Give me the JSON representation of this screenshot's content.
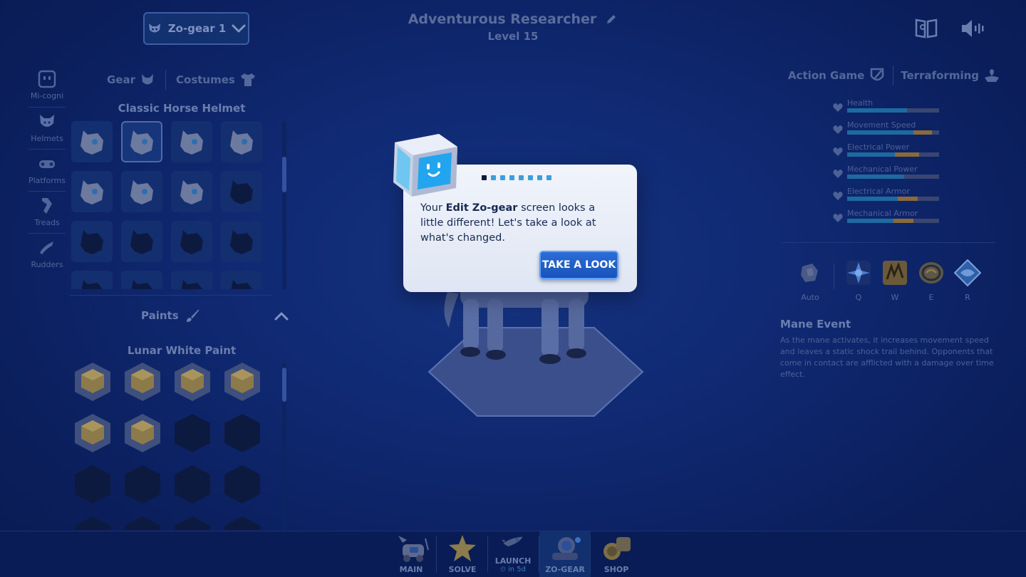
{
  "header": {
    "title": "Adventurous Researcher",
    "level": "Level 15"
  },
  "dropdown": {
    "label": "Zo-gear 1"
  },
  "sidebar": {
    "items": [
      {
        "label": "Mi-cogni",
        "icon": "mi-cogni-icon"
      },
      {
        "label": "Helmets",
        "icon": "helmet-icon"
      },
      {
        "label": "Platforms",
        "icon": "platform-icon"
      },
      {
        "label": "Treads",
        "icon": "tread-icon"
      },
      {
        "label": "Rudders",
        "icon": "rudder-icon"
      }
    ]
  },
  "gear_tabs": {
    "gear": "Gear",
    "costumes": "Costumes"
  },
  "helmets": {
    "selected_name": "Classic Horse Helmet",
    "items": [
      {
        "unlocked": true
      },
      {
        "unlocked": true,
        "selected": true
      },
      {
        "unlocked": true
      },
      {
        "unlocked": true
      },
      {
        "unlocked": true
      },
      {
        "unlocked": true
      },
      {
        "unlocked": true
      },
      {
        "unlocked": false
      },
      {
        "unlocked": false
      },
      {
        "unlocked": false
      },
      {
        "unlocked": false
      },
      {
        "unlocked": false
      },
      {
        "unlocked": false
      },
      {
        "unlocked": false
      },
      {
        "unlocked": false
      },
      {
        "unlocked": false
      }
    ]
  },
  "paints": {
    "label": "Paints",
    "selected_name": "Lunar White Paint",
    "items": [
      {
        "unlocked": true
      },
      {
        "unlocked": true
      },
      {
        "unlocked": true
      },
      {
        "unlocked": true
      },
      {
        "unlocked": true
      },
      {
        "unlocked": true
      },
      {
        "unlocked": false
      },
      {
        "unlocked": false
      },
      {
        "unlocked": false
      },
      {
        "unlocked": false
      },
      {
        "unlocked": false
      },
      {
        "unlocked": false
      },
      {
        "unlocked": false
      },
      {
        "unlocked": false
      },
      {
        "unlocked": false
      },
      {
        "unlocked": false
      }
    ]
  },
  "mode_tabs": {
    "action_game": "Action Game",
    "terraforming": "Terraforming"
  },
  "stats": [
    {
      "label": "Health",
      "value": 0.65,
      "icon": "heart-icon"
    },
    {
      "label": "Movement Speed",
      "value": 0.72,
      "bonus": 0.2,
      "icon": "speed-icon"
    },
    {
      "label": "Electrical Power",
      "value": 0.52,
      "bonus": 0.26,
      "icon": "electric-icon"
    },
    {
      "label": "Mechanical Power",
      "value": 0.62,
      "icon": "gear-power-icon"
    },
    {
      "label": "Electrical Armor",
      "value": 0.55,
      "bonus": 0.22,
      "icon": "electric-armor-icon"
    },
    {
      "label": "Mechanical Armor",
      "value": 0.5,
      "bonus": 0.22,
      "icon": "mechanical-armor-icon"
    }
  ],
  "abilities": [
    {
      "key": "Auto"
    },
    {
      "key": "Q"
    },
    {
      "key": "W"
    },
    {
      "key": "E"
    },
    {
      "key": "R"
    }
  ],
  "ability_detail": {
    "title": "Mane Event",
    "description": "As the mane activates, it increases movement speed and leaves a static shock trail behind. Opponents that come in contact are afflicted with a damage over time effect."
  },
  "tutorial": {
    "steps_total": 8,
    "step_current": 1,
    "text_before": "Your ",
    "text_bold": "Edit Zo-gear",
    "text_after": " screen looks a little different! Let's take a look at what's changed.",
    "button": "TAKE A LOOK"
  },
  "bottom_nav": [
    {
      "label": "MAIN"
    },
    {
      "label": "SOLVE"
    },
    {
      "label": "LAUNCH",
      "sub": "⏲ in 5d"
    },
    {
      "label": "ZO-GEAR",
      "active": true
    },
    {
      "label": "SHOP"
    }
  ],
  "colors": {
    "background": "#0c2266",
    "accent": "#3a9fdc",
    "button": "#1b52b8",
    "dialog": "#eef2fa"
  }
}
